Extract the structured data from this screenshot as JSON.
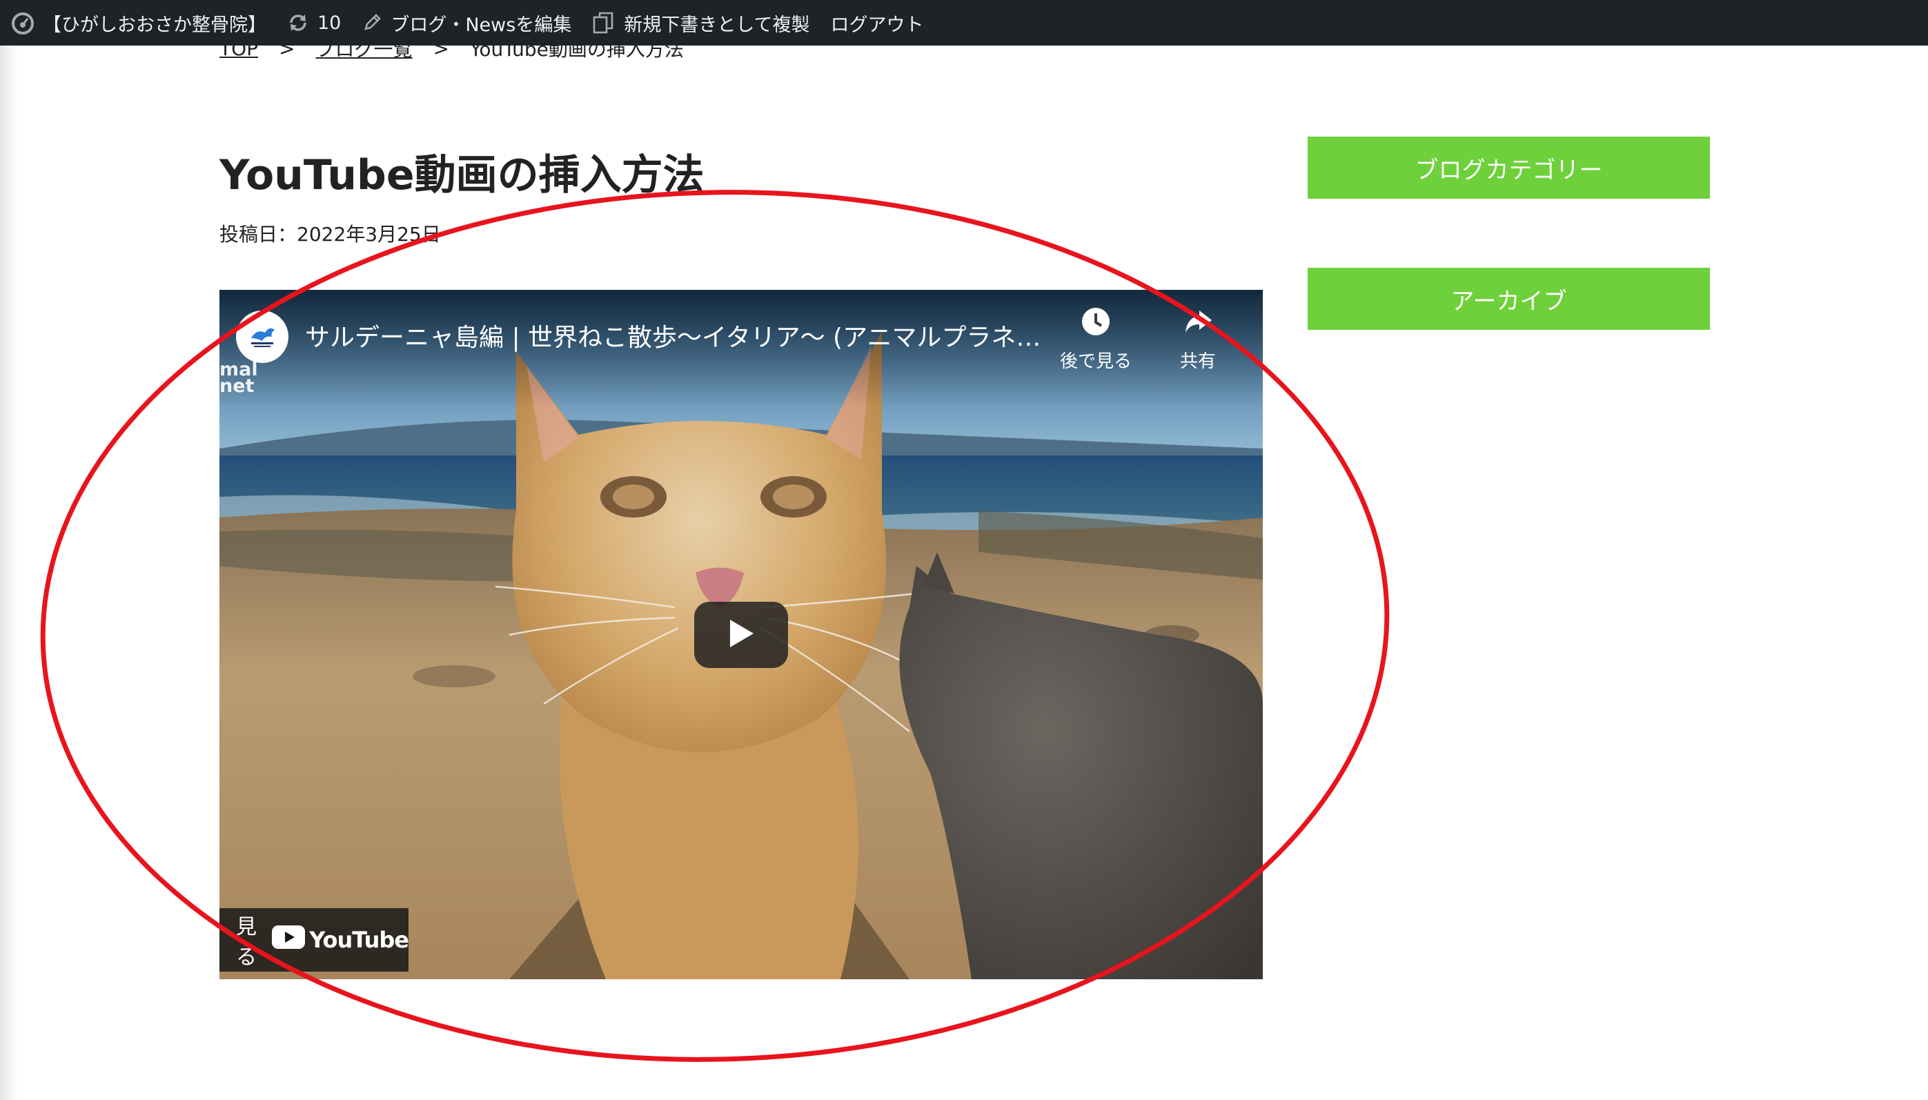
{
  "adminbar": {
    "site_name": "【ひがしおおさか整骨院】",
    "updates_count": "10",
    "edit_label": "ブログ・Newsを編集",
    "duplicate_label": "新規下書きとして複製",
    "logout_label": "ログアウト"
  },
  "breadcrumb": {
    "items": [
      "TOP",
      "ブログ一覧",
      "YouTube動画の挿入方法"
    ],
    "separator": ">"
  },
  "post": {
    "title": "YouTube動画の挿入方法",
    "date": "投稿日：2022年3月25日"
  },
  "video": {
    "title": "サルデーニャ島編 | 世界ねこ散歩〜イタリア〜 (アニマルプラネット)",
    "channel_watermark": "mal\nnet",
    "watch_later_label": "後で見る",
    "share_label": "共有",
    "watch_on_label": "見る",
    "youtube_wordmark": "YouTube",
    "channel_icon": "animal-planet-logo"
  },
  "sidebar": {
    "buttons": [
      "ブログカテゴリー",
      "アーカイブ"
    ]
  },
  "colors": {
    "adminbar_bg": "#1d2327",
    "sidebar_button": "#6ed03a",
    "annotation": "#e8141d",
    "youtube_red": "#ff0000"
  }
}
